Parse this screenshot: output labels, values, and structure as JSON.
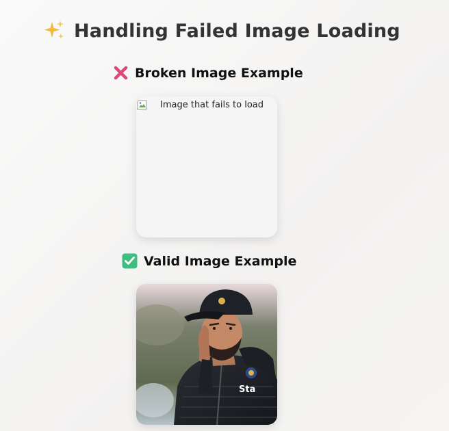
{
  "title": {
    "icon": "sparkles-icon",
    "text": "Handling Failed Image Loading"
  },
  "broken_section": {
    "icon": "cross-mark-icon",
    "heading": "Broken Image Example",
    "alt_text": "Image that fails to load"
  },
  "valid_section": {
    "icon": "check-mark-icon",
    "heading": "Valid Image Example",
    "image_icon": "portrait-photo"
  },
  "colors": {
    "cross": "#e0457b",
    "check": "#3fbf7f",
    "sparkle": "#f6b73c"
  }
}
